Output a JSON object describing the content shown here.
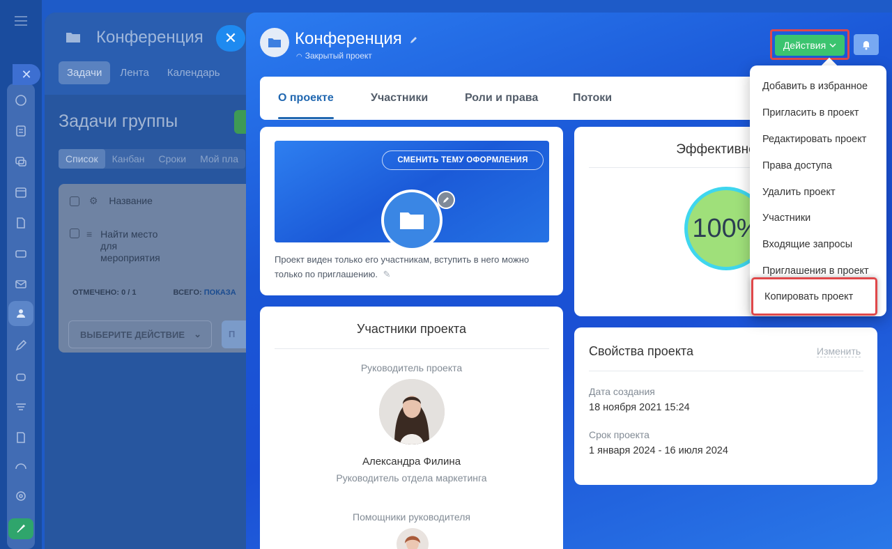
{
  "background_panel": {
    "title": "Конференция",
    "tabs": [
      "Задачи",
      "Лента",
      "Календарь"
    ],
    "heading": "Задачи группы",
    "view_tabs": [
      "Список",
      "Канбан",
      "Сроки",
      "Мой пла"
    ],
    "column_header": "Название",
    "task": {
      "line1": "Найти место",
      "line2": "для",
      "line3": "мероприятия"
    },
    "footer_marked_label": "ОТМЕЧЕНО:",
    "footer_marked_value": "0 / 1",
    "footer_total_label": "ВСЕГО:",
    "footer_total_link": "ПОКАЗА",
    "action_select": "ВЫБЕРИТЕ ДЕЙСТВИЕ",
    "apply_btn": "П"
  },
  "project": {
    "title": "Конференция",
    "subtitle": "Закрытый проект",
    "actions_label": "Действия"
  },
  "tabs": [
    "О проекте",
    "Участники",
    "Роли и права",
    "Потоки"
  ],
  "about": {
    "theme_button": "СМЕНИТЬ ТЕМУ ОФОРМЛЕНИЯ",
    "description": "Проект виден только его участникам, вступить в него можно только по приглашению."
  },
  "members": {
    "title": "Участники проекта",
    "head_role": "Руководитель проекта",
    "head_name": "Александра Филина",
    "head_position": "Руководитель отдела маркетинга",
    "assistants_label": "Помощники руководителя"
  },
  "efficiency": {
    "title": "Эффективность",
    "value": "100%"
  },
  "properties": {
    "title": "Свойства проекта",
    "edit_link": "Изменить",
    "created_label": "Дата создания",
    "created_value": "18 ноября 2021 15:24",
    "term_label": "Срок проекта",
    "term_value": "1 января 2024 - 16 июля 2024"
  },
  "menu": {
    "items": [
      "Добавить в избранное",
      "Пригласить в проект",
      "Редактировать проект",
      "Права доступа",
      "Удалить проект",
      "Участники",
      "Входящие запросы",
      "Приглашения в проект",
      "Копировать проект"
    ]
  },
  "colors": {
    "accent_green": "#3bc46f",
    "highlight_red": "#e0484a",
    "link_blue": "#2067b0"
  }
}
